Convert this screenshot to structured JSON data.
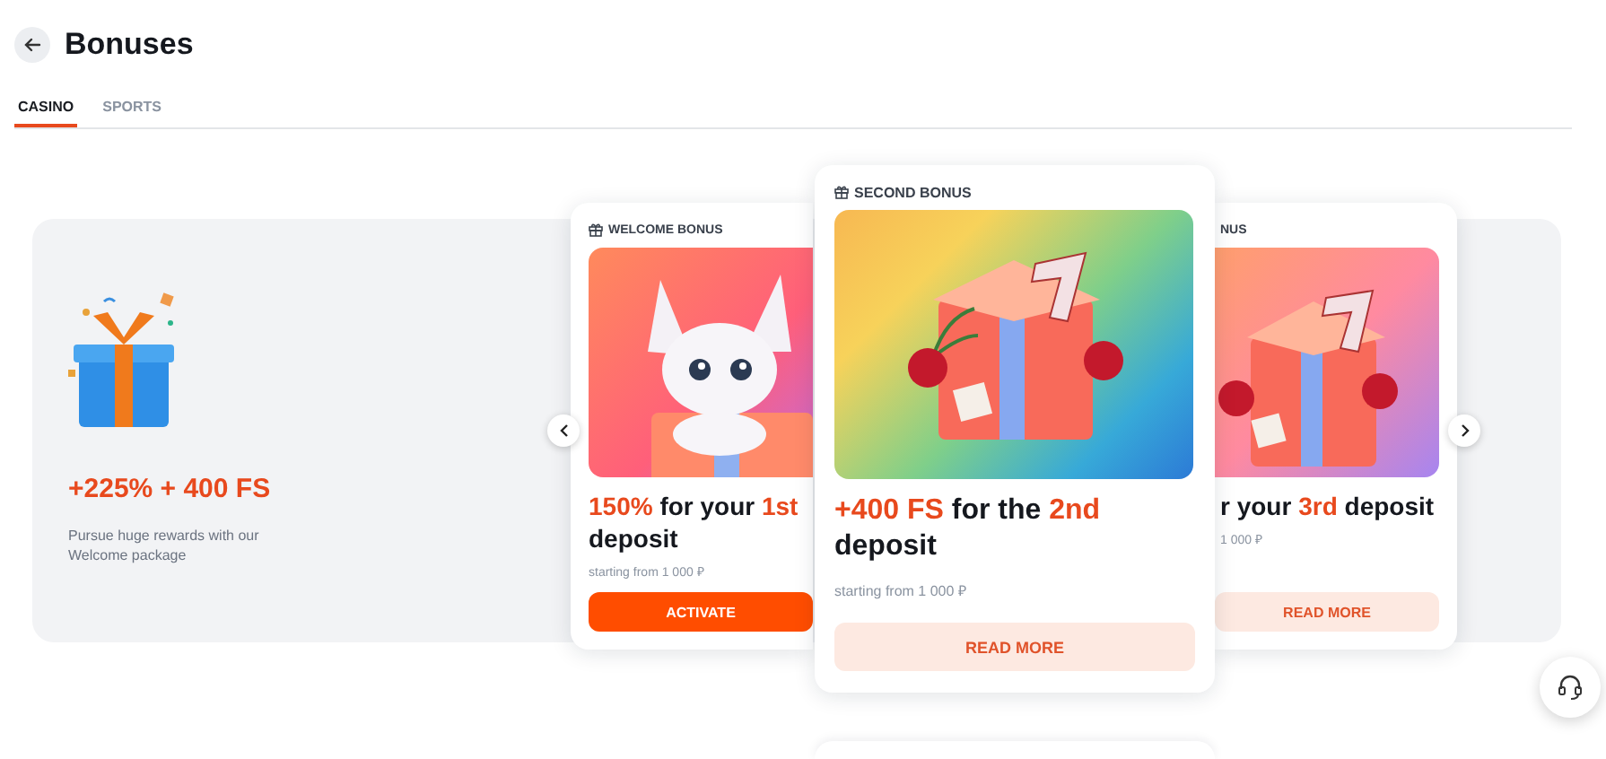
{
  "page": {
    "title": "Bonuses"
  },
  "tabs": [
    {
      "label": "CASINO",
      "selected": true
    },
    {
      "label": "SPORTS",
      "selected": false
    }
  ],
  "promo": {
    "headline": "+225% + 400 FS",
    "description": "Pursue huge rewards with our Welcome package"
  },
  "cards": [
    {
      "label": "WELCOME BONUS",
      "title": "**150%** for your **1st** deposit",
      "min_deposit": "starting from 1 000 ₽",
      "button": {
        "label": "ACTIVATE",
        "kind": "primary"
      }
    },
    {
      "label": "SECOND BONUS",
      "title": "**+400 FS** for the **2nd** deposit",
      "min_deposit": "starting from 1 000 ₽",
      "button": {
        "label": "READ MORE",
        "kind": "secondary"
      }
    },
    {
      "label": "NUS",
      "title": "r your **3rd** deposit",
      "min_deposit": "1 000 ₽",
      "button": {
        "label": "READ MORE",
        "kind": "secondary"
      }
    }
  ]
}
